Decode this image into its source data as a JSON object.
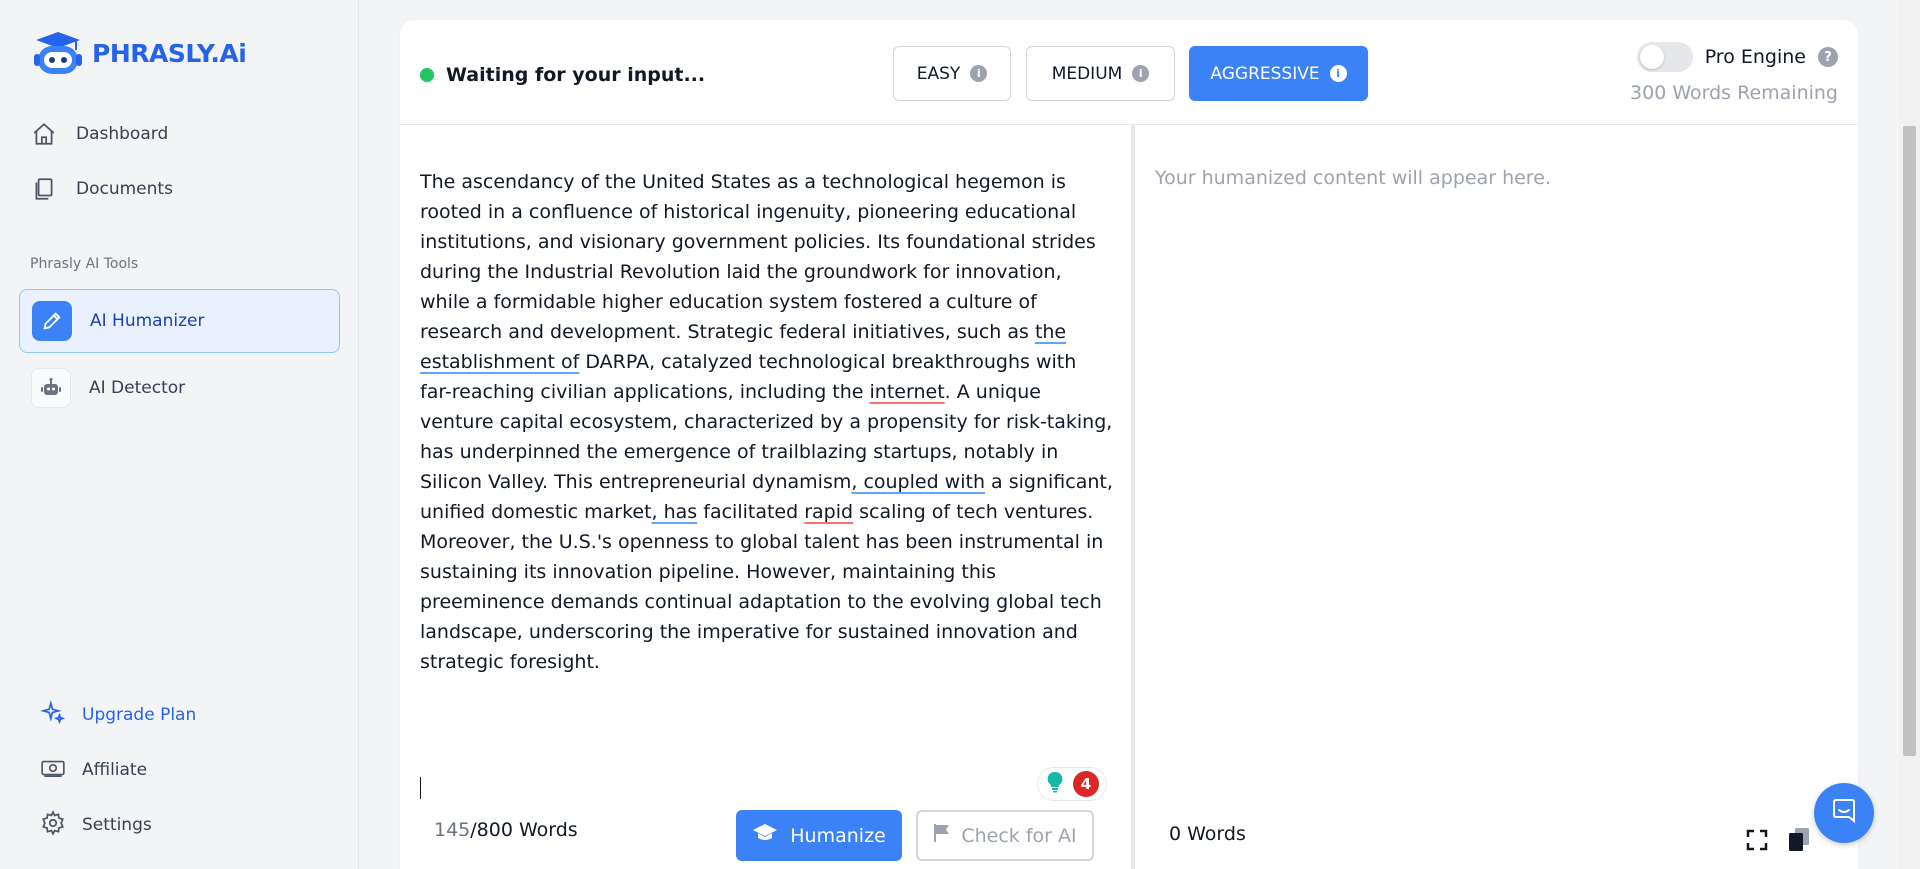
{
  "app": {
    "logo_text": "PHRASLY.Ai"
  },
  "sidebar": {
    "nav": [
      {
        "label": "Dashboard",
        "icon": "home-icon"
      },
      {
        "label": "Documents",
        "icon": "documents-icon"
      }
    ],
    "section_label": "Phrasly AI Tools",
    "tools": [
      {
        "label": "AI Humanizer",
        "icon": "pencil-icon",
        "active": true
      },
      {
        "label": "AI Detector",
        "icon": "robot-icon",
        "active": false
      }
    ],
    "bottom": [
      {
        "label": "Upgrade Plan",
        "icon": "sparkles-icon"
      },
      {
        "label": "Affiliate",
        "icon": "money-icon"
      },
      {
        "label": "Settings",
        "icon": "gear-icon"
      }
    ]
  },
  "topbar": {
    "status_text": "Waiting for your input...",
    "status_color": "#22c55e",
    "modes": [
      {
        "label": "EASY",
        "active": false
      },
      {
        "label": "MEDIUM",
        "active": false
      },
      {
        "label": "AGGRESSIVE",
        "active": true
      }
    ],
    "pro_engine_label": "Pro Engine",
    "pro_engine_enabled": false,
    "words_remaining": "300 Words Remaining"
  },
  "editor": {
    "segments": [
      {
        "text": "The ascendancy of the United States as a technological hegemon is rooted in a confluence of historical ingenuity, pioneering educational institutions, and visionary government policies. Its foundational strides during the Industrial Revolution laid the groundwork for innovation, while a formidable higher education system fostered a culture of research and development. Strategic federal initiatives, such as ",
        "mark": "none"
      },
      {
        "text": "the establishment of",
        "mark": "blue"
      },
      {
        "text": " DARPA, catalyzed technological breakthroughs with far-reaching civilian applications, including the ",
        "mark": "none"
      },
      {
        "text": "internet",
        "mark": "red"
      },
      {
        "text": ". A unique venture capital ecosystem, characterized by a propensity for risk-taking, has underpinned the emergence of trailblazing startups, notably in Silicon Valley. This entrepreneurial dynamism",
        "mark": "none"
      },
      {
        "text": ", coupled with",
        "mark": "blue"
      },
      {
        "text": " a significant, unified domestic market",
        "mark": "none"
      },
      {
        "text": ", has",
        "mark": "blue"
      },
      {
        "text": " facilitated ",
        "mark": "none"
      },
      {
        "text": "rapid",
        "mark": "red"
      },
      {
        "text": " scaling of tech ventures. Moreover, the U.S.'s openness to global talent has been instrumental in sustaining its innovation pipeline. However, maintaining this preeminence demands continual adaptation to the evolving global tech landscape, underscoring the imperative for sustained innovation and strategic foresight.",
        "mark": "none"
      }
    ],
    "grammar_count": "4",
    "word_count_current": "145",
    "word_count_suffix": "/800 Words",
    "humanize_label": "Humanize",
    "check_label": "Check for AI"
  },
  "output": {
    "placeholder": "Your humanized content will appear here.",
    "word_count": "0 Words"
  },
  "colors": {
    "accent": "#3b82f6",
    "brand": "#2563eb"
  }
}
